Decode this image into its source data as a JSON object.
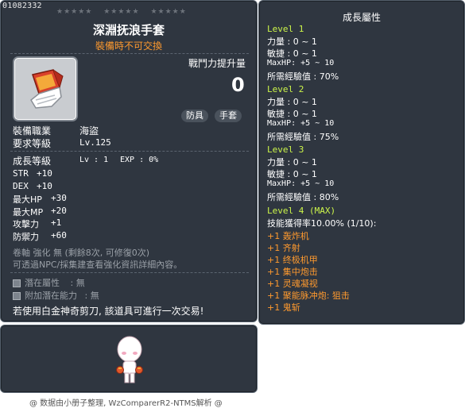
{
  "item_id": "01082332",
  "item_name": "深淵抚浪手套",
  "trade_note": "裝備時不可交換",
  "power_label": "戰鬥力提升量",
  "power_value": "0",
  "tags": [
    "防具",
    "手套"
  ],
  "job": {
    "label": "裝備職業",
    "value": "海盜"
  },
  "req_level": {
    "label": "要求等級",
    "value": "Lv.125"
  },
  "growth": {
    "label": "成長等級",
    "lv": "Lv : 1",
    "exp": "EXP : 0%"
  },
  "stats": [
    {
      "name": "STR",
      "value": "+10"
    },
    {
      "name": "DEX",
      "value": "+10"
    },
    {
      "name": "最大HP",
      "value": "+30"
    },
    {
      "name": "最大MP",
      "value": "+20"
    },
    {
      "name": "攻擊力",
      "value": "+1"
    },
    {
      "name": "防禦力",
      "value": "+60"
    }
  ],
  "scroll_line": "卷軸 強化 無 (剩餘8次, 可修復0次)",
  "npc_line": "可透過NPC/採集建查看強化資訊詳細內容。",
  "potential": {
    "label": "潛在屬性",
    "value": ": 無"
  },
  "bonus_potential": {
    "label": "附加潛在能力",
    "value": ": 無"
  },
  "cut_note": "若使用白金神奇剪刀, 該道具可進行一次交易!",
  "growth_panel": {
    "title": "成長屬性",
    "levels": [
      {
        "name": "Level 1",
        "lines": [
          "力量 : 0 ~ 1",
          "敏捷 : 0 ~ 1",
          "MaxHP: +5 ~ 10",
          "所需經驗值 : 70%"
        ]
      },
      {
        "name": "Level 2",
        "lines": [
          "力量 : 0 ~ 1",
          "敏捷 : 0 ~ 1",
          "MaxHP: +5 ~ 10",
          "所需經驗值 : 75%"
        ]
      },
      {
        "name": "Level 3",
        "lines": [
          "力量 : 0 ~ 1",
          "敏捷 : 0 ~ 1",
          "MaxHP: +5 ~ 10",
          "所需經驗值 : 80%"
        ]
      }
    ],
    "level4": "Level 4 (MAX)",
    "skill_rate": "技能獲得率10.00% (1/10):",
    "skills": [
      "+1 轰炸机",
      "+1 齐射",
      "+1 终极机甲",
      "+1 集中炮击",
      "+1 灵魂凝视",
      "+1 聚能脉冲炮: 狙击",
      "+1 鬼斩"
    ]
  },
  "footer": "@ 数据由小册子整理, WzComparerR2-NTMS解析 @",
  "colors": {
    "panel_bg": "#2f3640",
    "level_green": "#ccf54a",
    "skill_orange": "#ff9a2e",
    "title_orange": "#ff9a2e"
  }
}
